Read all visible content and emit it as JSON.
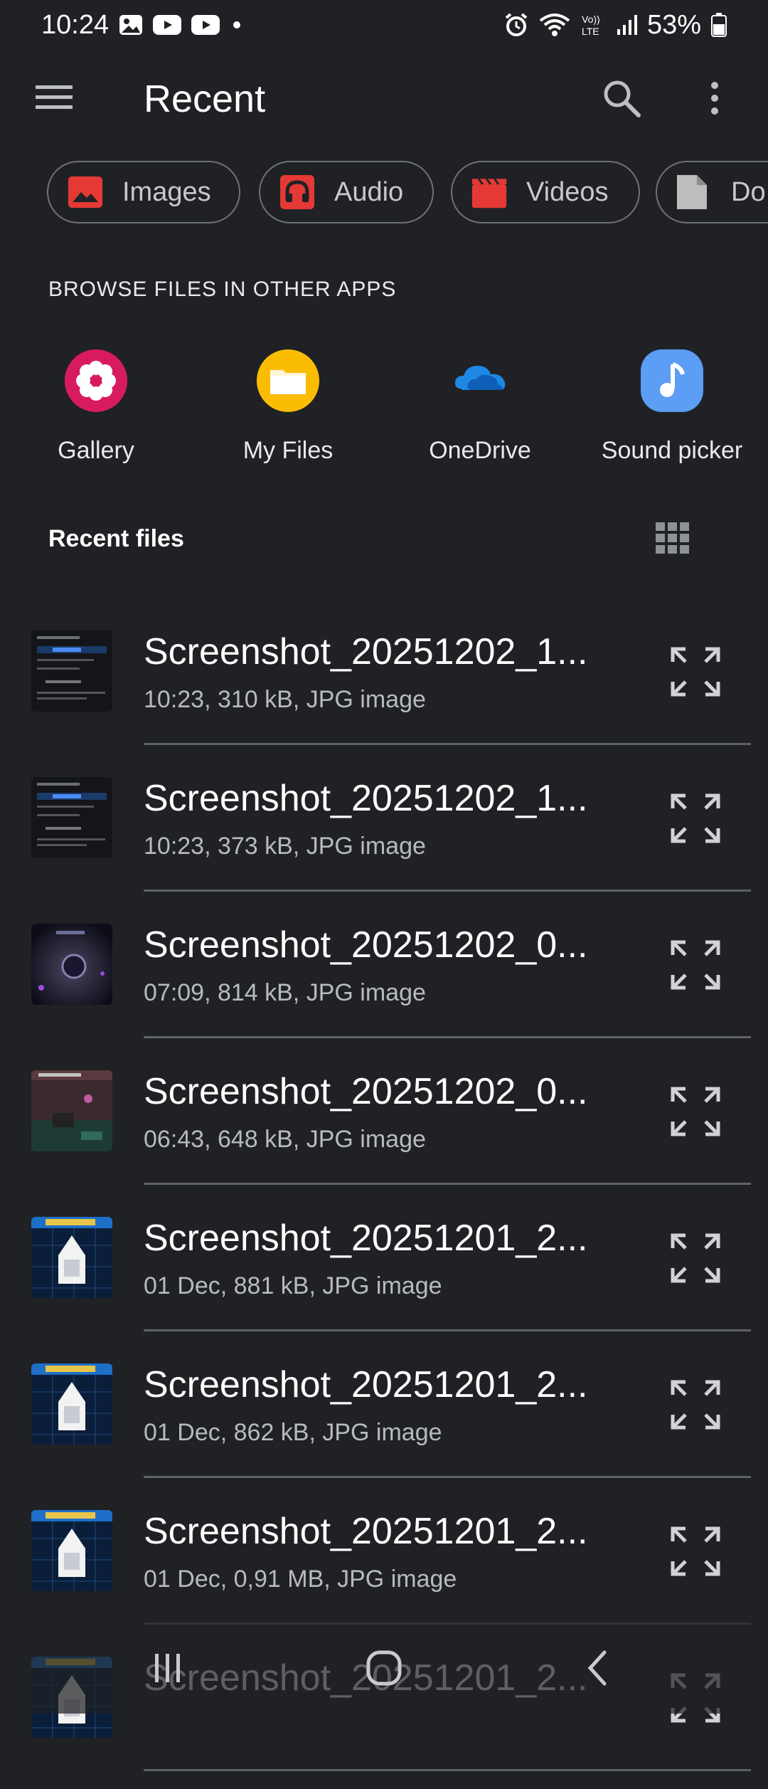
{
  "status_bar": {
    "time": "10:24",
    "battery": "53%",
    "left_icons": [
      "gallery-notification-icon",
      "youtube-icon",
      "youtube-icon",
      "dot-icon"
    ],
    "right_icons": [
      "alarm-icon",
      "wifi-icon",
      "volte-icon",
      "signal-icon",
      "battery-icon"
    ],
    "volte_label": "Vo)) LTE"
  },
  "app_bar": {
    "title": "Recent"
  },
  "chips": [
    {
      "label": "Images",
      "icon": "image-icon",
      "color": "#e53935"
    },
    {
      "label": "Audio",
      "icon": "headphones-icon",
      "color": "#e53935"
    },
    {
      "label": "Videos",
      "icon": "clapperboard-icon",
      "color": "#e53935"
    },
    {
      "label": "Do",
      "icon": "document-icon",
      "color": "#bdbdbd"
    }
  ],
  "browse_section": {
    "label": "BROWSE FILES IN OTHER APPS",
    "apps": [
      {
        "label": "Gallery",
        "icon": "gallery-flower-icon",
        "color": "#d81b60"
      },
      {
        "label": "My Files",
        "icon": "folder-icon",
        "color": "#fbbc04"
      },
      {
        "label": "OneDrive",
        "icon": "cloud-icon",
        "color": "#1e88e5"
      },
      {
        "label": "Sound picker",
        "icon": "music-note-icon",
        "color": "#5c9df5"
      }
    ]
  },
  "recent_files": {
    "header": "Recent files",
    "view_icon": "grid-view-icon",
    "items": [
      {
        "name": "Screenshot_20251202_1...",
        "meta": "10:23, 310 kB, JPG image",
        "thumb": "dark-ui"
      },
      {
        "name": "Screenshot_20251202_1...",
        "meta": "10:23, 373 kB, JPG image",
        "thumb": "dark-ui"
      },
      {
        "name": "Screenshot_20251202_0...",
        "meta": "07:09, 814 kB, JPG image",
        "thumb": "space"
      },
      {
        "name": "Screenshot_20251202_0...",
        "meta": "06:43, 648 kB, JPG image",
        "thumb": "game"
      },
      {
        "name": "Screenshot_20251201_2...",
        "meta": "01 Dec, 881 kB, JPG image",
        "thumb": "ship"
      },
      {
        "name": "Screenshot_20251201_2...",
        "meta": "01 Dec, 862 kB, JPG image",
        "thumb": "ship"
      },
      {
        "name": "Screenshot_20251201_2...",
        "meta": "01 Dec, 0,91 MB, JPG image",
        "thumb": "ship"
      },
      {
        "name": "Screenshot_20251201_2...",
        "meta": "",
        "thumb": "ship"
      }
    ]
  },
  "nav_bar": {
    "buttons": [
      "recents-icon",
      "home-icon",
      "back-icon"
    ]
  }
}
